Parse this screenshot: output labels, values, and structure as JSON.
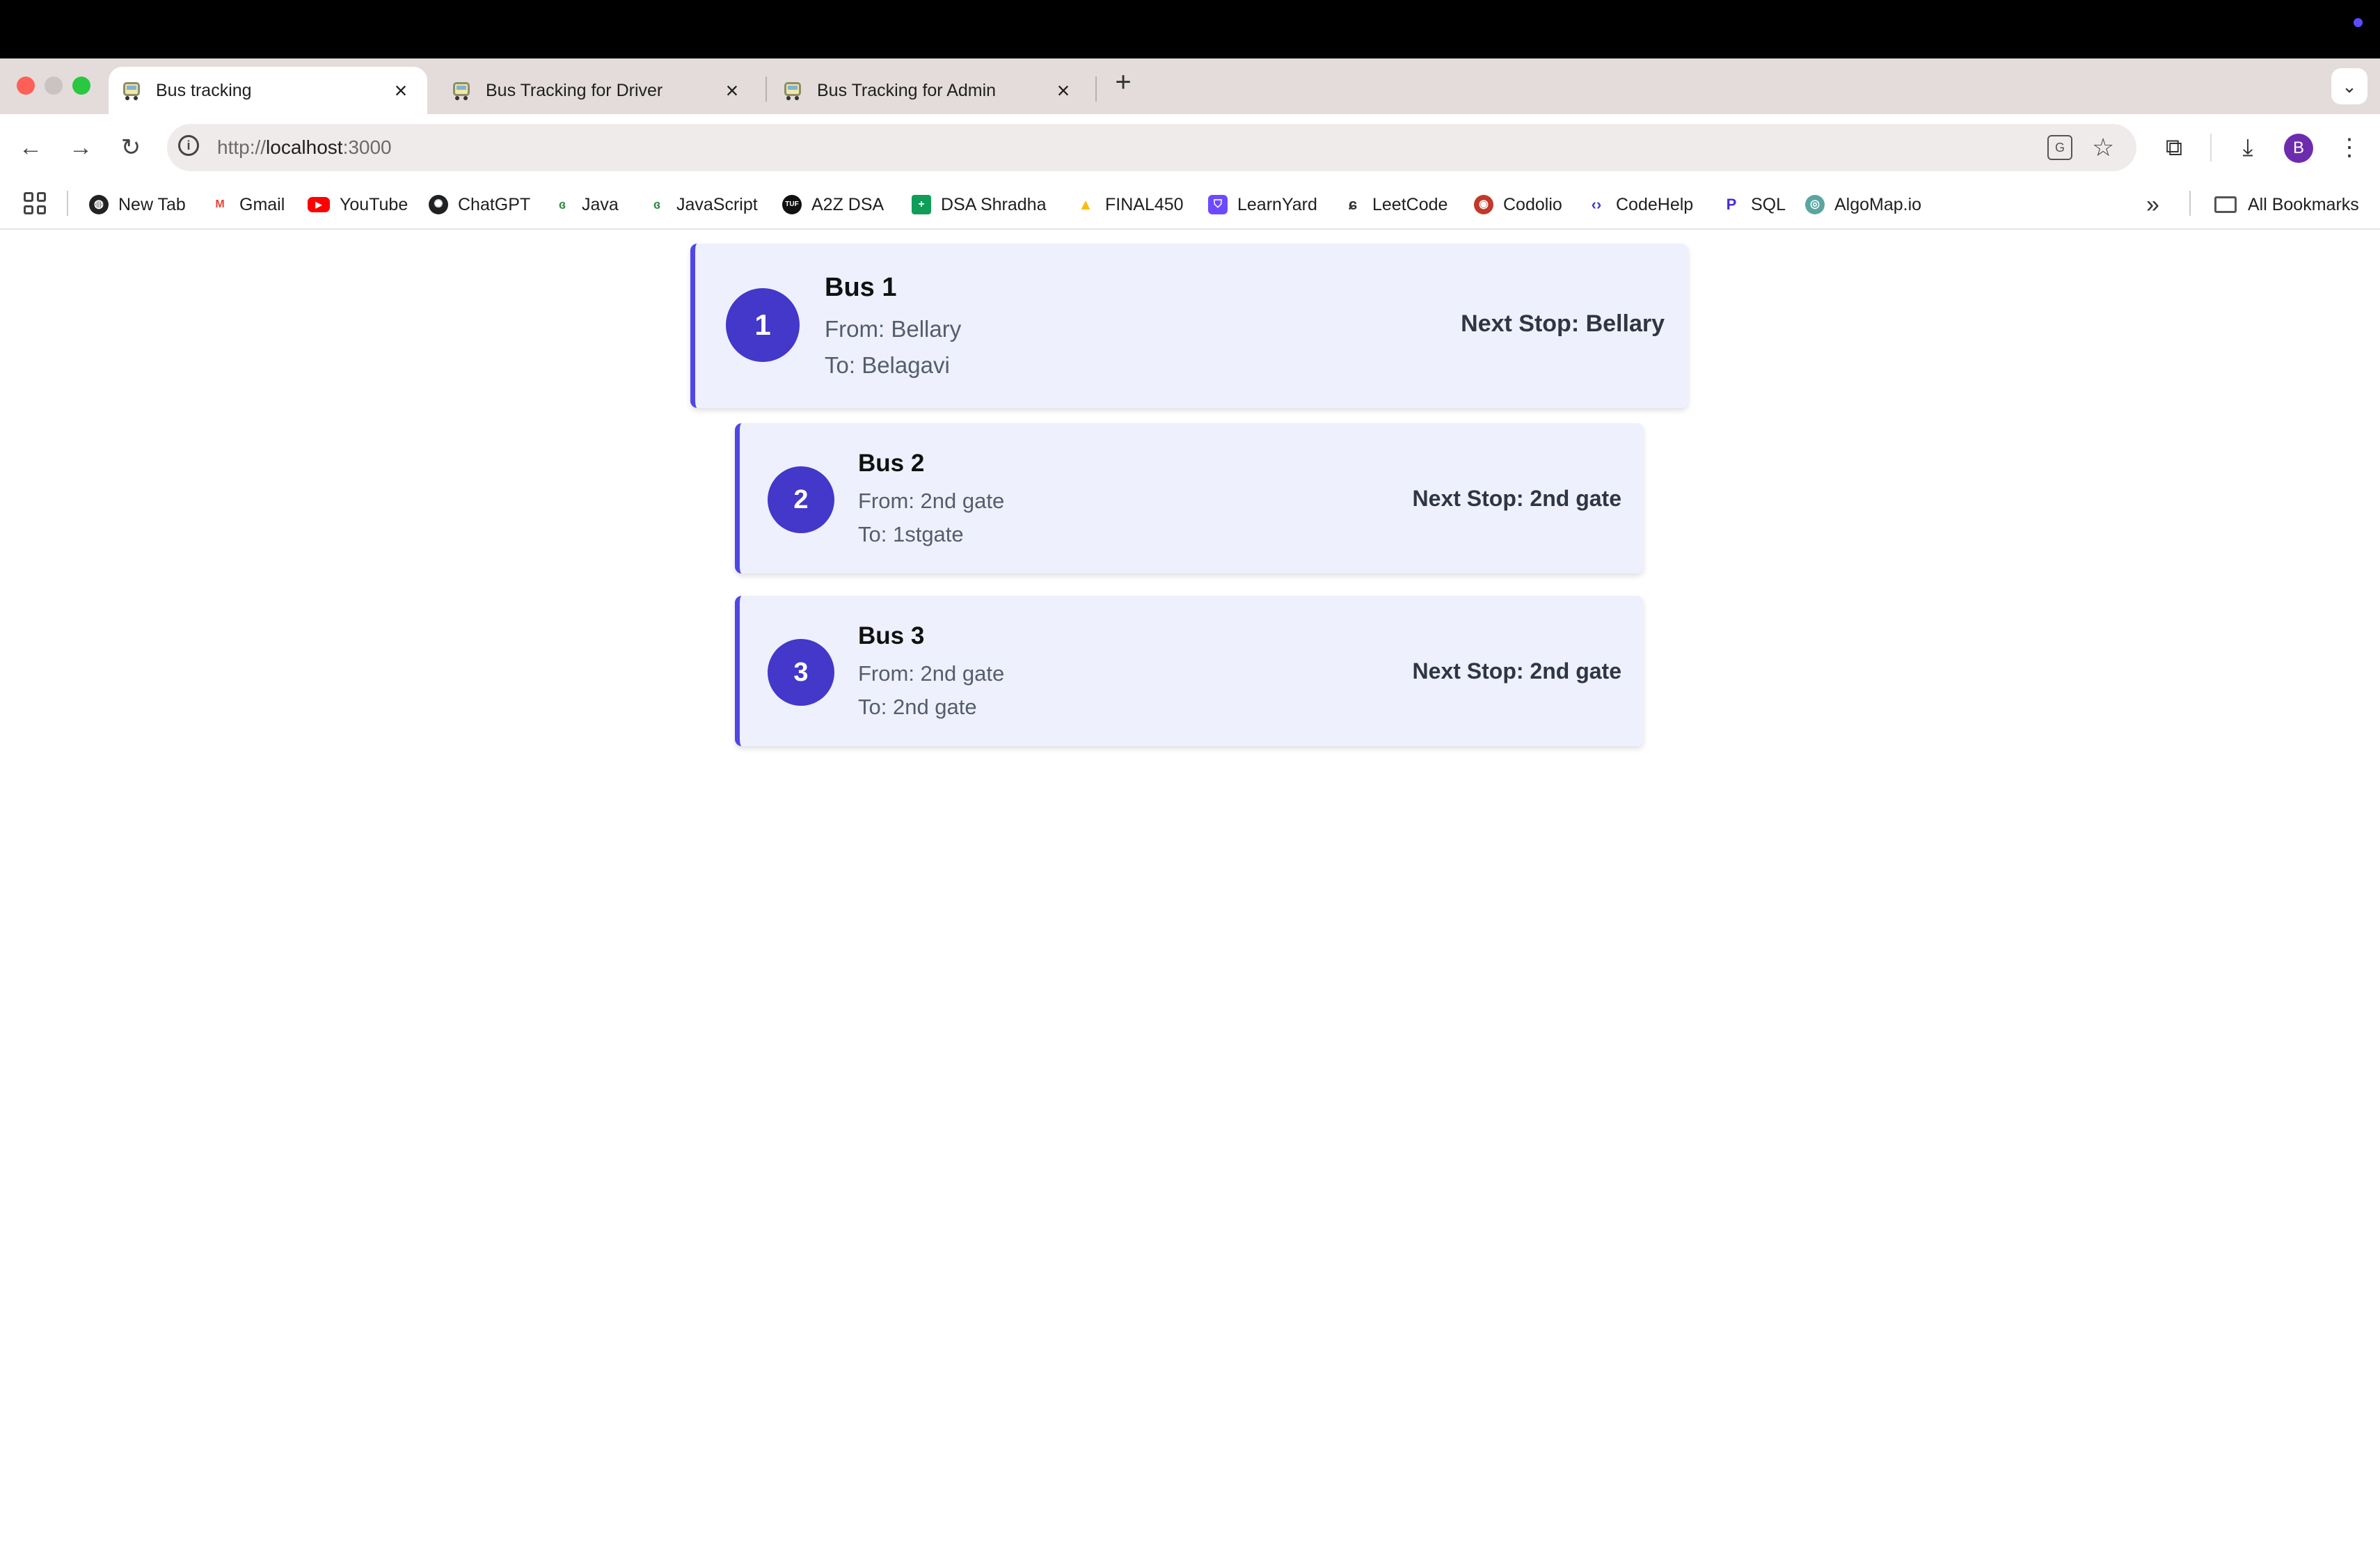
{
  "browser": {
    "tabs": [
      {
        "title": "Bus tracking",
        "active": true
      },
      {
        "title": "Bus Tracking for Driver",
        "active": false
      },
      {
        "title": "Bus Tracking for Admin",
        "active": false
      }
    ],
    "new_tab_icon": "plus-icon",
    "url": {
      "scheme": "http://",
      "host": "localhost",
      "port_path": ":3000"
    },
    "avatar_letter": "B",
    "bookmarks": [
      {
        "label": "New Tab",
        "icon": "globe-icon",
        "color": "#222222"
      },
      {
        "label": "Gmail",
        "icon": "gmail-icon",
        "color": "#ea4335"
      },
      {
        "label": "YouTube",
        "icon": "youtube-icon",
        "color": "#ff0000"
      },
      {
        "label": "ChatGPT",
        "icon": "chatgpt-icon",
        "color": "#202123"
      },
      {
        "label": "Java",
        "icon": "gfg-icon",
        "color": "#2f8d46"
      },
      {
        "label": "JavaScript",
        "icon": "gfg-icon",
        "color": "#2f8d46"
      },
      {
        "label": "A2Z DSA",
        "icon": "tuf-icon",
        "color": "#111111"
      },
      {
        "label": "DSA Shradha",
        "icon": "sheets-icon",
        "color": "#0f9d58"
      },
      {
        "label": "FINAL450",
        "icon": "drive-icon",
        "color": "#fbbc04"
      },
      {
        "label": "LearnYard",
        "icon": "learnyard-icon",
        "color": "#6d4aff"
      },
      {
        "label": "LeetCode",
        "icon": "leetcode-icon",
        "color": "#ffa116"
      },
      {
        "label": "Codolio",
        "icon": "codolio-icon",
        "color": "#c0392b"
      },
      {
        "label": "CodeHelp",
        "icon": "codehelp-icon",
        "color": "#3b3bd6"
      },
      {
        "label": "SQL",
        "icon": "sql-icon",
        "color": "#4b2bd8"
      },
      {
        "label": "AlgoMap.io",
        "icon": "algomap-icon",
        "color": "#5aa5a0"
      }
    ],
    "all_bookmarks_label": "All Bookmarks"
  },
  "buses": [
    {
      "number": "1",
      "name": "Bus 1",
      "from": "From: Bellary",
      "to": "To: Belagavi",
      "next_stop": "Next Stop: Bellary"
    },
    {
      "number": "2",
      "name": "Bus 2",
      "from": "From: 2nd gate",
      "to": "To: 1stgate",
      "next_stop": "Next Stop: 2nd gate"
    },
    {
      "number": "3",
      "name": "Bus 3",
      "from": "From: 2nd gate",
      "to": "To: 2nd gate",
      "next_stop": "Next Stop: 2nd gate"
    }
  ],
  "colors": {
    "accent": "#4f46e5",
    "badge": "#4338ca",
    "card_bg": "#eef0fd"
  }
}
